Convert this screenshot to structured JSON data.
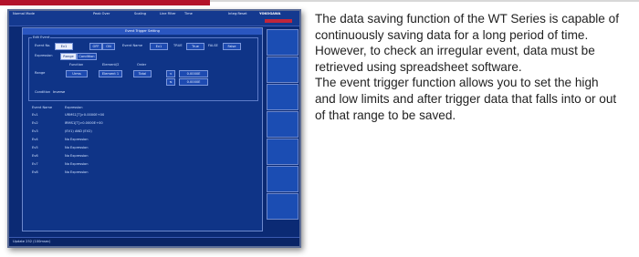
{
  "colors": {
    "accent_red": "#b3122a",
    "screen_bg": "#0b2a74",
    "text": "#222222"
  },
  "screen": {
    "header": {
      "mode": "Normal Mode",
      "peak": "Peak Over",
      "scaling": "Scaling",
      "hold": "Line Filter",
      "time": "Time",
      "reset": "Integ:Reset",
      "brand": "YOKOGAWA"
    },
    "panel_title": "Event Trigger Setting",
    "edit_box_label": "Edit Event",
    "event_no_label": "Event No.",
    "event_no_value": "Ev1",
    "onoff_labels": [
      "OFF",
      "ON"
    ],
    "event_name_label": "Event Name",
    "event_name_value": "Ev1",
    "true_label": "TRUE",
    "true_value": "True",
    "false_label": "FALSE",
    "false_value": "False",
    "expression_label": "Expression",
    "expression_types": [
      "Range",
      "Condition"
    ],
    "function_label": "Function",
    "element_label": "Element/Σ",
    "order_label": "Order",
    "range_label": "Range",
    "function_value": "Urms",
    "element_value": "Element 1",
    "order_value": "Total",
    "range_low": "0.0000E",
    "range_high": "0.0000E",
    "range_ops": [
      "<",
      "≤"
    ],
    "condition_label": "Condition",
    "condition_value": "Inverse",
    "list_headers": {
      "name": "Event Name",
      "expr": "Expression"
    },
    "events": [
      {
        "name": "Ev1",
        "expr": "URMS1[T]>0.0000E+00"
      },
      {
        "name": "Ev2",
        "expr": "IRMS1[T]>0.0000E+00"
      },
      {
        "name": "Ev3",
        "expr": "(EV1) AND (EV2)"
      },
      {
        "name": "Ev4",
        "expr": "No Expression"
      },
      {
        "name": "Ev5",
        "expr": "No Expression"
      },
      {
        "name": "Ev6",
        "expr": "No Expression"
      },
      {
        "name": "Ev7",
        "expr": "No Expression"
      },
      {
        "name": "Ev8",
        "expr": "No Expression"
      }
    ],
    "footer": "Update 252 (100msec)"
  },
  "description": {
    "p1": "The data saving function of the WT Series is capable of continuously saving data for a long period of time. However, to check an irregular event, data must be retrieved using spreadsheet software.",
    "p2": "The event trigger function allows you to set the high and low limits and after trigger data that falls into or out of that range to be saved."
  }
}
